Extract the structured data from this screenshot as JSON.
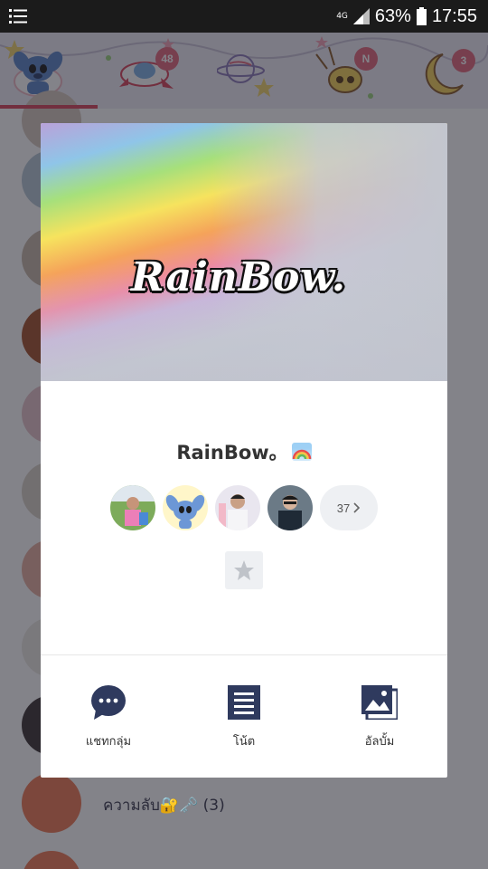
{
  "status_bar": {
    "network_type": "4G",
    "battery_percent": "63%",
    "time": "17:55"
  },
  "tab_bar": {
    "badges": [
      "48",
      "N",
      "3"
    ]
  },
  "background": {
    "last_visible_chat": "ความลับ🔐🗝️ (3)"
  },
  "group": {
    "cover_title": "RainBow.",
    "name": "RainBow。",
    "name_emoji_icon": "rainbow-icon",
    "member_count": "37"
  },
  "actions": [
    {
      "label": "แชทกลุ่ม",
      "icon": "chat-bubble-icon"
    },
    {
      "label": "โน้ต",
      "icon": "note-icon"
    },
    {
      "label": "อัลบั้ม",
      "icon": "album-icon"
    }
  ],
  "colors": {
    "accent": "#d9465c",
    "icon_navy": "#2f3a5e",
    "badge": "#e5697c"
  }
}
